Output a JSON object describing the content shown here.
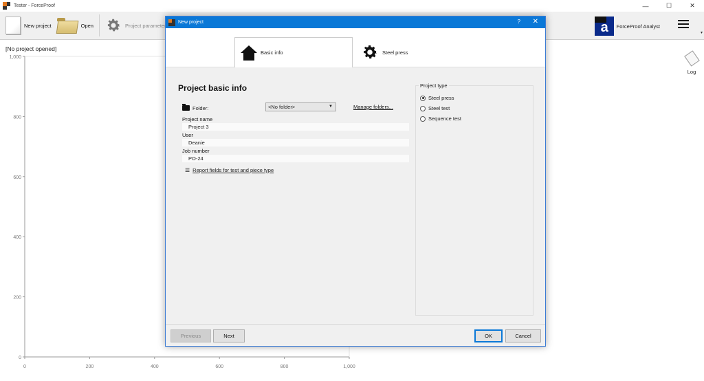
{
  "window": {
    "title": "Tester - ForceProof",
    "controls": {
      "minimize": "—",
      "maximize": "☐",
      "close": "✕"
    }
  },
  "toolbar": {
    "new_project": "New project",
    "open": "Open",
    "project_parameters": "Project parameters",
    "analyst": "ForceProof Analyst",
    "analyst_logo_letter": "a"
  },
  "status": "[No project opened]",
  "side": {
    "log": "Log"
  },
  "chart_data": {
    "type": "line",
    "x_ticks": [
      "0",
      "200",
      "400",
      "600",
      "800",
      "1,000"
    ],
    "y_ticks": [
      "0",
      "200",
      "400",
      "600",
      "800",
      "1,000"
    ],
    "xlim": [
      0,
      1000
    ],
    "ylim": [
      0,
      1000
    ],
    "series": []
  },
  "dialog": {
    "title": "New project",
    "help": "?",
    "close": "✕",
    "tabs": [
      {
        "label": "Basic info",
        "icon": "house-icon",
        "active": true
      },
      {
        "label": "Steel press",
        "icon": "gear-icon",
        "active": false
      }
    ],
    "section_title": "Project basic info",
    "folder": {
      "label": "Folder:",
      "value": "<No folder>",
      "manage_link": "Manage folders..."
    },
    "fields": {
      "project_name": {
        "label": "Project name",
        "value": "Project 3"
      },
      "user": {
        "label": "User",
        "value": "Deanie"
      },
      "job_number": {
        "label": "Job number",
        "value": "PO-24"
      }
    },
    "report_link": "Report fields for test and piece type",
    "project_type": {
      "legend": "Project type",
      "options": [
        {
          "label": "Steel press",
          "selected": true
        },
        {
          "label": "Steel test",
          "selected": false
        },
        {
          "label": "Sequence test",
          "selected": false
        }
      ]
    },
    "buttons": {
      "previous": "Previous",
      "next": "Next",
      "ok": "OK",
      "cancel": "Cancel"
    }
  }
}
